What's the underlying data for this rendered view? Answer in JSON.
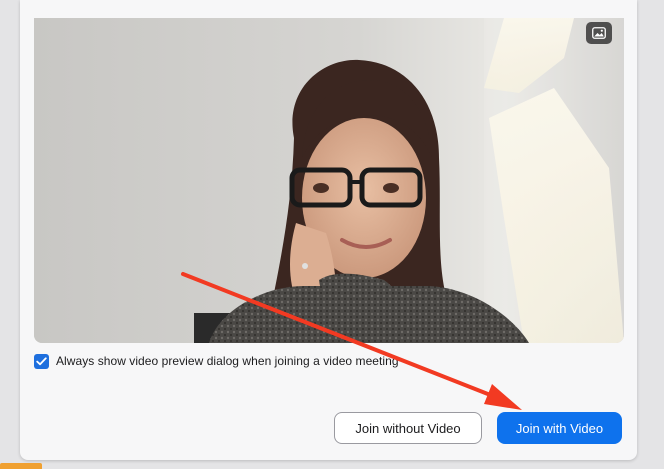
{
  "preview": {
    "background_icon": "image-icon"
  },
  "options": {
    "always_show_preview": {
      "label": "Always show video preview dialog when joining a video meeting",
      "checked": true
    }
  },
  "buttons": {
    "join_without_video": "Join without Video",
    "join_with_video": "Join with Video"
  },
  "annotation": {
    "arrow_color": "#f23a22"
  },
  "colors": {
    "primary": "#0e72ed",
    "checkbox": "#1e6fde"
  }
}
